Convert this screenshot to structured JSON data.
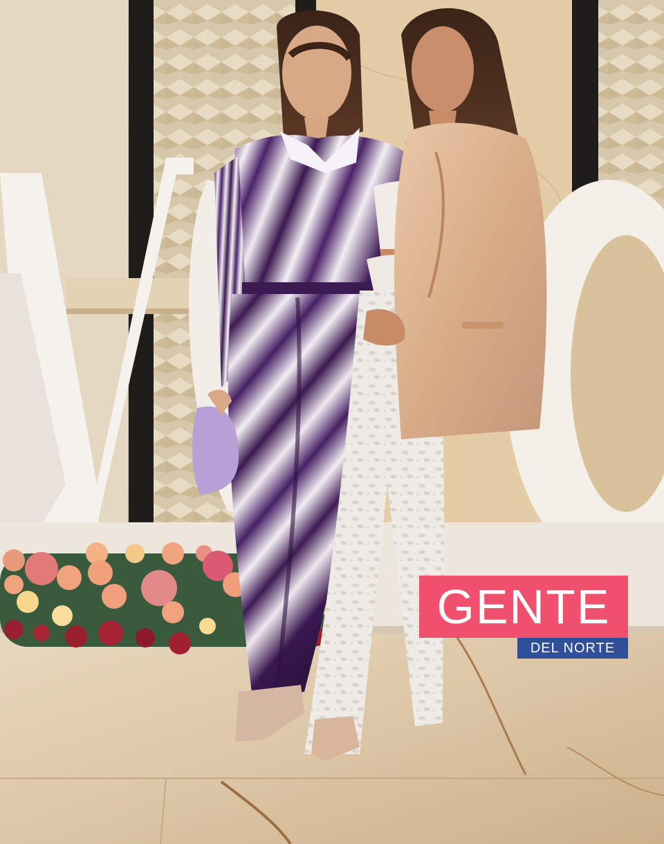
{
  "logo": {
    "main": "GENTE",
    "sub": "DEL NORTE"
  },
  "colors": {
    "logo_pink": "#f0506e",
    "logo_blue": "#2f4f9a"
  }
}
